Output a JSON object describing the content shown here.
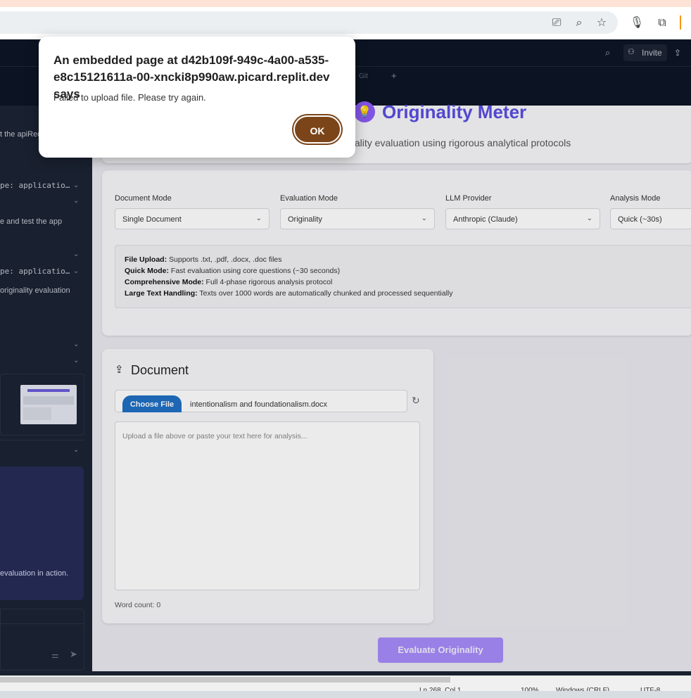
{
  "browser": {
    "icons": [
      "install-app-icon",
      "zoom-icon",
      "bookmark-star-icon",
      "microphone-icon",
      "extensions-icon"
    ]
  },
  "workspace": {
    "invite_label": "Invite",
    "tabs": [
      "Git"
    ],
    "add_tab": "+"
  },
  "sidebar": {
    "lines": [
      "t the apiReq",
      "pe: applicatio…",
      "e and test the app",
      "pe: applicatio…",
      "originality evaluation",
      "evaluation in action."
    ]
  },
  "app": {
    "title": "Originality Meter",
    "subtitle": "inality evaluation using rigorous analytical protocols",
    "controls": [
      {
        "label": "Document Mode",
        "value": "Single Document"
      },
      {
        "label": "Evaluation Mode",
        "value": "Originality"
      },
      {
        "label": "LLM Provider",
        "value": "Anthropic (Claude)"
      },
      {
        "label": "Analysis Mode",
        "value": "Quick (~30s)"
      }
    ],
    "info": [
      {
        "key": "File Upload:",
        "text": " Supports .txt, .pdf, .docx, .doc files"
      },
      {
        "key": "Quick Mode:",
        "text": " Fast evaluation using core questions (~30 seconds)"
      },
      {
        "key": "Comprehensive Mode:",
        "text": " Full 4-phase rigorous analysis protocol"
      },
      {
        "key": "Large Text Handling:",
        "text": " Texts over 1000 words are automatically chunked and processed sequentially"
      }
    ],
    "document": {
      "heading": "Document",
      "choose_file": "Choose File",
      "file_name": "intentionalism and foundationalism.docx",
      "placeholder": "Upload a file above or paste your text here for analysis...",
      "word_count": "Word count: 0"
    },
    "evaluate_button": "Evaluate Originality"
  },
  "status": {
    "position": "Ln 268, Col 1",
    "zoom": "100%",
    "eol": "Windows (CRLF)",
    "encoding": "UTF-8"
  },
  "dialog": {
    "title": "An embedded page at d42b109f-949c-4a00-a535-e8c15121611a-00-xncki8p990aw.picard.replit.dev says",
    "message": "Failed to upload file. Please try again.",
    "ok": "OK"
  },
  "colors": {
    "accent_purple": "#7c5ce0",
    "ok_button": "#7b4519",
    "choose_file_blue": "#1f6fc4"
  }
}
